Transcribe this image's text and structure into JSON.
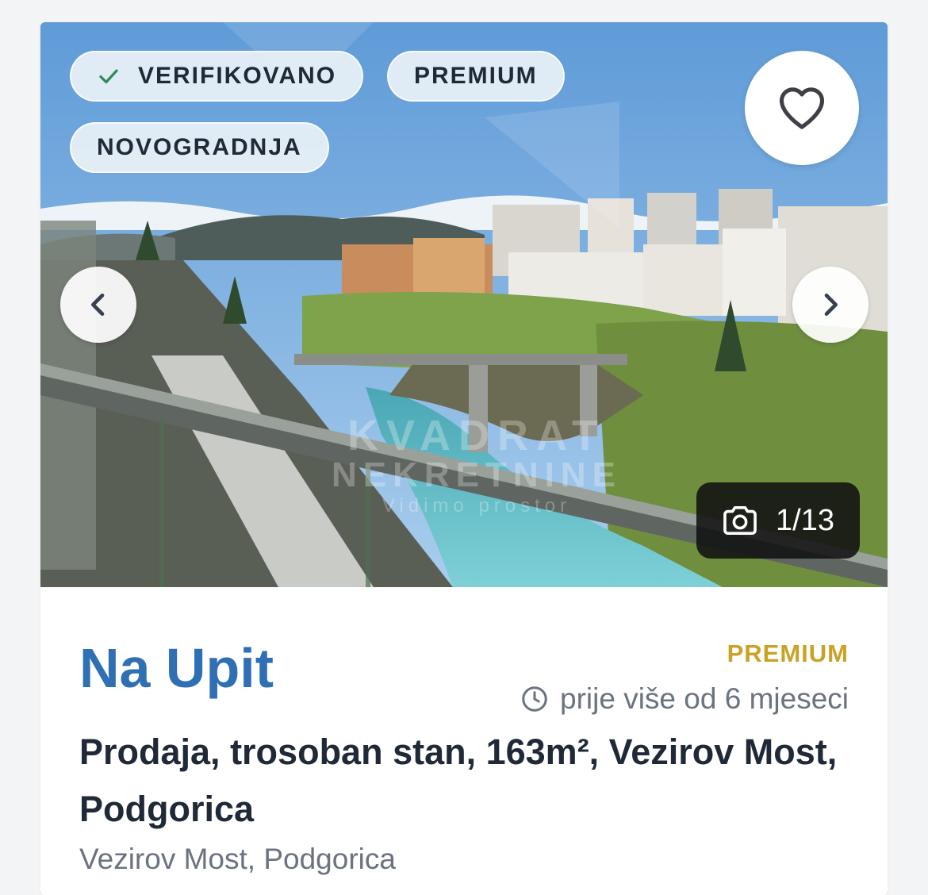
{
  "badges": {
    "verified": "VERIFIKOVANO",
    "premium": "PREMIUM",
    "new_build": "NOVOGRADNJA"
  },
  "gallery": {
    "counter": "1/13",
    "icons": {
      "favorite": "heart-icon",
      "prev": "chevron-left-icon",
      "next": "chevron-right-icon",
      "camera": "camera-icon",
      "verified": "check-icon"
    }
  },
  "watermark": {
    "line1": "KVADRAT",
    "line2": "NEKRETNINE",
    "line3": "Vidimo prostor"
  },
  "listing": {
    "price": "Na Upit",
    "premium_label": "PREMIUM",
    "posted": "prije više od 6 mjeseci",
    "title": "Prodaja, trosoban stan, 163m², Vezirov Most, Podgorica",
    "location": "Vezirov Most, Podgorica"
  },
  "colors": {
    "price": "#2f6fb3",
    "premium": "#c9a227",
    "verified_check": "#2e8b57"
  }
}
